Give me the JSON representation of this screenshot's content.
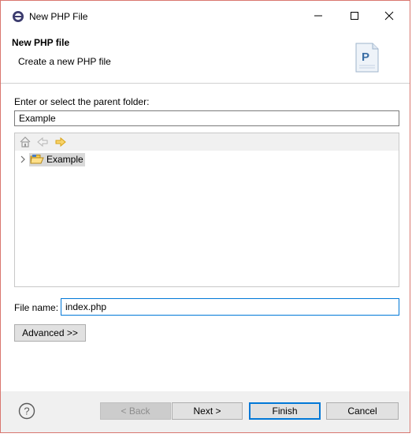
{
  "window": {
    "title": "New PHP File",
    "border_color": "#d9766f"
  },
  "header": {
    "title": "New PHP file",
    "description": "Create a new PHP file",
    "icon": "php-file-icon"
  },
  "parent_folder": {
    "label": "Enter or select the parent folder:",
    "value": "Example"
  },
  "tree": {
    "toolbar": [
      "home-icon",
      "back-arrow-icon",
      "forward-arrow-icon"
    ],
    "items": [
      {
        "label": "Example",
        "icon": "project-folder-icon",
        "expanded": false,
        "selected": true
      }
    ]
  },
  "file_name": {
    "label": "File name:",
    "value": "index.php"
  },
  "buttons": {
    "advanced": "Advanced >>",
    "back": "< Back",
    "next": "Next >",
    "finish": "Finish",
    "cancel": "Cancel"
  },
  "colors": {
    "accent": "#0078d7",
    "selection": "#d9d9d9"
  }
}
